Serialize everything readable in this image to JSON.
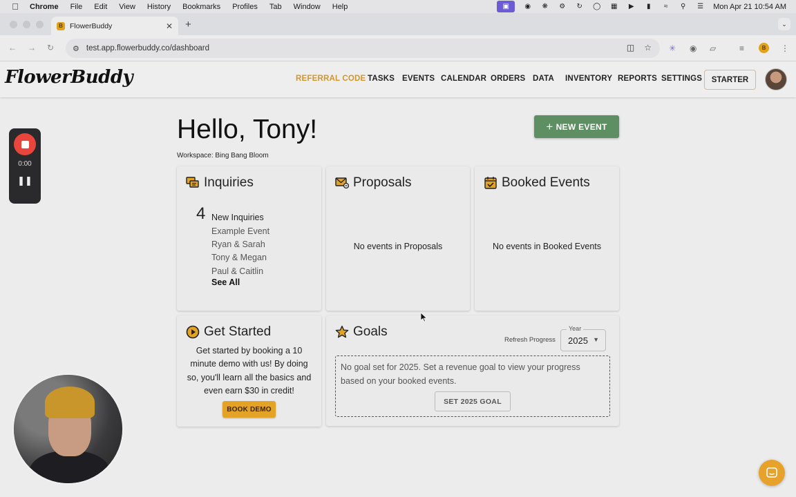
{
  "menubar": {
    "app": "Chrome",
    "items": [
      "File",
      "Edit",
      "View",
      "History",
      "Bookmarks",
      "Profiles",
      "Tab",
      "Window",
      "Help"
    ],
    "clock": "Mon Apr 21  10:54 AM"
  },
  "browser": {
    "tab_title": "FlowerBuddy",
    "favicon_letter": "B",
    "url": "test.app.flowerbuddy.co/dashboard"
  },
  "app": {
    "logo": "FlowerBuddy",
    "nav": [
      {
        "label": "REFERRAL CODE",
        "accent": true
      },
      {
        "label": "TASKS"
      },
      {
        "label": "EVENTS"
      },
      {
        "label": "CALENDAR"
      },
      {
        "label": "ORDERS"
      },
      {
        "label": "DATA"
      },
      {
        "label": "INVENTORY"
      },
      {
        "label": "REPORTS"
      },
      {
        "label": "SETTINGS"
      }
    ],
    "plan_button": "STARTER",
    "accent_color": "#d4952a"
  },
  "recorder": {
    "time": "0:00"
  },
  "dashboard": {
    "greeting": "Hello, Tony!",
    "workspace": "Workspace: Bing Bang Bloom",
    "new_event_label": "NEW EVENT",
    "inquiries": {
      "title": "Inquiries",
      "count": "4",
      "count_label": "New Inquiries",
      "items": [
        "Example Event",
        "Ryan & Sarah",
        "Tony & Megan",
        "Paul & Caitlin"
      ],
      "see_all": "See All"
    },
    "proposals": {
      "title": "Proposals",
      "empty": "No events in Proposals"
    },
    "booked": {
      "title": "Booked Events",
      "empty": "No events in Booked Events"
    },
    "get_started": {
      "title": "Get Started",
      "text": "Get started by booking a 10 minute demo with us! By doing so, you'll learn all the basics and even earn $30 in credit!",
      "button": "BOOK DEMO"
    },
    "goals": {
      "title": "Goals",
      "refresh": "Refresh Progress",
      "year_label": "Year",
      "year_value": "2025",
      "message": "No goal set for 2025. Set a revenue goal to view your progress based on your booked events.",
      "button": "SET 2025 GOAL"
    }
  }
}
